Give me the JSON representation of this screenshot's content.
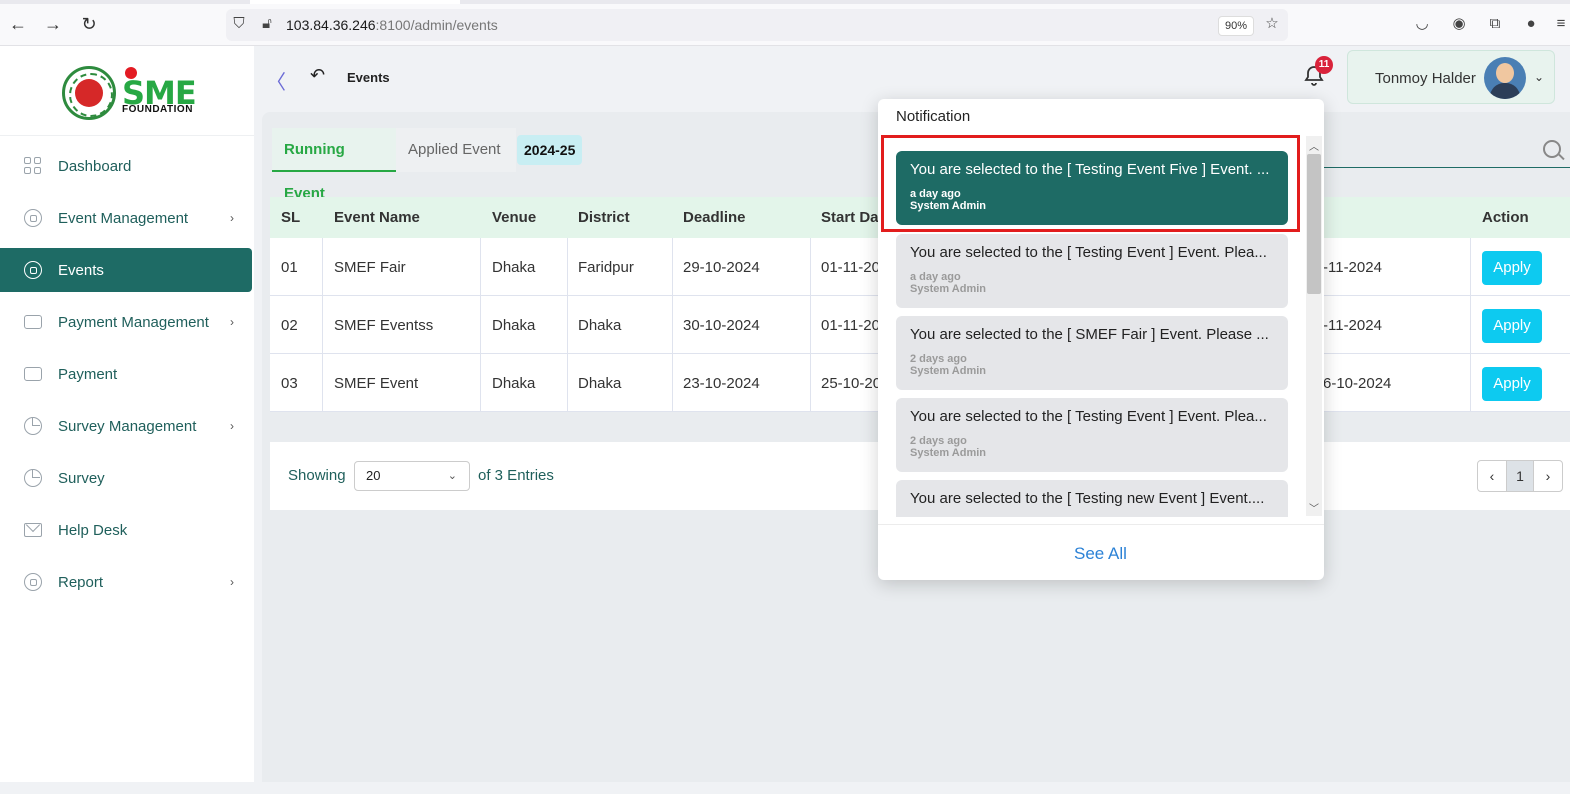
{
  "browser": {
    "url_host": "103.84.36.246",
    "url_rest": ":8100/admin/events",
    "zoom": "90%"
  },
  "sidebar": {
    "logo_text": "SME",
    "logo_sub": "FOUNDATION",
    "items": [
      {
        "label": "Dashboard",
        "icon": "dashboard-grid-icon",
        "has_submenu": false
      },
      {
        "label": "Event Management",
        "icon": "lock-circle-icon",
        "has_submenu": true
      },
      {
        "label": "Events",
        "icon": "lock-circle-icon",
        "has_submenu": false,
        "active": true
      },
      {
        "label": "Payment Management",
        "icon": "card-icon",
        "has_submenu": true
      },
      {
        "label": "Payment",
        "icon": "card-icon",
        "has_submenu": false
      },
      {
        "label": "Survey Management",
        "icon": "pie-chart-icon",
        "has_submenu": true
      },
      {
        "label": "Survey",
        "icon": "pie-chart-icon",
        "has_submenu": false
      },
      {
        "label": "Help Desk",
        "icon": "mail-icon",
        "has_submenu": false
      },
      {
        "label": "Report",
        "icon": "lock-circle-icon",
        "has_submenu": true
      }
    ],
    "caret": "›"
  },
  "header": {
    "collapse_glyph": "〈",
    "back_glyph": "↶",
    "title": "Events",
    "notification_count": "11",
    "user_name": "Tonmoy Halder",
    "user_caret": "⌄"
  },
  "tabs": {
    "running": "Running Event",
    "applied": "Applied Event",
    "year": "2024-25"
  },
  "table": {
    "columns": [
      "SL",
      "Event Name",
      "Venue",
      "District",
      "Deadline",
      "Start Da",
      "Action"
    ],
    "rows": [
      {
        "sl": "01",
        "name": "SMEF Fair",
        "venue": "Dhaka",
        "district": "Faridpur",
        "deadline": "29-10-2024",
        "start": "01-11-20",
        "end": "-11-2024",
        "action": "Apply"
      },
      {
        "sl": "02",
        "name": "SMEF Eventss",
        "venue": "Dhaka",
        "district": "Dhaka",
        "deadline": "30-10-2024",
        "start": "01-11-20",
        "end": "-11-2024",
        "action": "Apply"
      },
      {
        "sl": "03",
        "name": "SMEF Event",
        "venue": "Dhaka",
        "district": "Dhaka",
        "deadline": "23-10-2024",
        "start": "25-10-20",
        "end": "6-10-2024",
        "action": "Apply"
      }
    ]
  },
  "pagination": {
    "showing": "Showing",
    "per_page": "20",
    "entries": "of 3 Entries",
    "prev": "‹",
    "page": "1",
    "next": "›"
  },
  "notifications": {
    "title": "Notification",
    "items": [
      {
        "msg": "You are selected to the [ Testing Event Five ] Event. ...",
        "time": "a day ago",
        "from": "System Admin"
      },
      {
        "msg": "You are selected to the [ Testing Event ] Event. Plea...",
        "time": "a day ago",
        "from": "System Admin"
      },
      {
        "msg": "You are selected to the [ SMEF Fair ] Event. Please ...",
        "time": "2 days ago",
        "from": "System Admin"
      },
      {
        "msg": "You are selected to the [ Testing Event ] Event. Plea...",
        "time": "2 days ago",
        "from": "System Admin"
      },
      {
        "msg": "You are selected to the [ Testing new Event ] Event....",
        "time": "",
        "from": ""
      }
    ],
    "see_all": "See All"
  },
  "colors": {
    "primary": "#1e6b65",
    "accent_green": "#27a844",
    "apply_button": "#0dcaf0",
    "highlight": "#e21d1d",
    "badge": "#d9233b"
  }
}
